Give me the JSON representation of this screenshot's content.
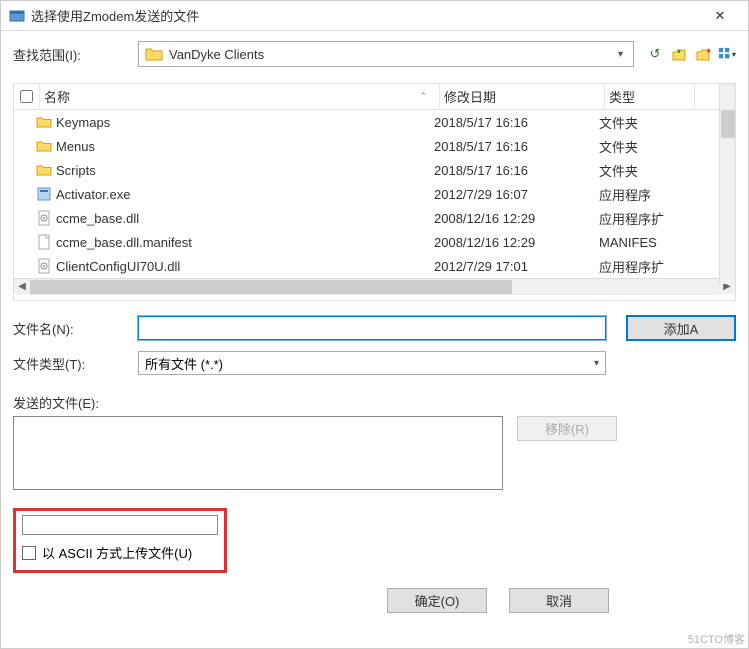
{
  "titlebar": {
    "title": "选择使用Zmodem发送的文件"
  },
  "browse": {
    "label": "查找范围(I):",
    "path": "VanDyke Clients"
  },
  "columns": {
    "name": "名称",
    "date": "修改日期",
    "type": "类型"
  },
  "files": [
    {
      "icon": "folder",
      "name": "Keymaps",
      "date": "2018/5/17 16:16",
      "type": "文件夹"
    },
    {
      "icon": "folder",
      "name": "Menus",
      "date": "2018/5/17 16:16",
      "type": "文件夹"
    },
    {
      "icon": "folder",
      "name": "Scripts",
      "date": "2018/5/17 16:16",
      "type": "文件夹"
    },
    {
      "icon": "exe",
      "name": "Activator.exe",
      "date": "2012/7/29 16:07",
      "type": "应用程序"
    },
    {
      "icon": "dll",
      "name": "ccme_base.dll",
      "date": "2008/12/16 12:29",
      "type": "应用程序扩"
    },
    {
      "icon": "file",
      "name": "ccme_base.dll.manifest",
      "date": "2008/12/16 12:29",
      "type": "MANIFES"
    },
    {
      "icon": "dll",
      "name": "ClientConfigUI70U.dll",
      "date": "2012/7/29 17:01",
      "type": "应用程序扩"
    }
  ],
  "filename": {
    "label": "文件名(N):",
    "value": ""
  },
  "filetype": {
    "label": "文件类型(T):",
    "value": "所有文件 (*.*)"
  },
  "sendfiles": {
    "label": "发送的文件(E):"
  },
  "buttons": {
    "add": "添加A",
    "remove": "移除(R)",
    "ok": "确定(O)",
    "cancel": "取消"
  },
  "ascii": {
    "label": "以 ASCII 方式上传文件(U)"
  },
  "watermark": "51CTO博客"
}
